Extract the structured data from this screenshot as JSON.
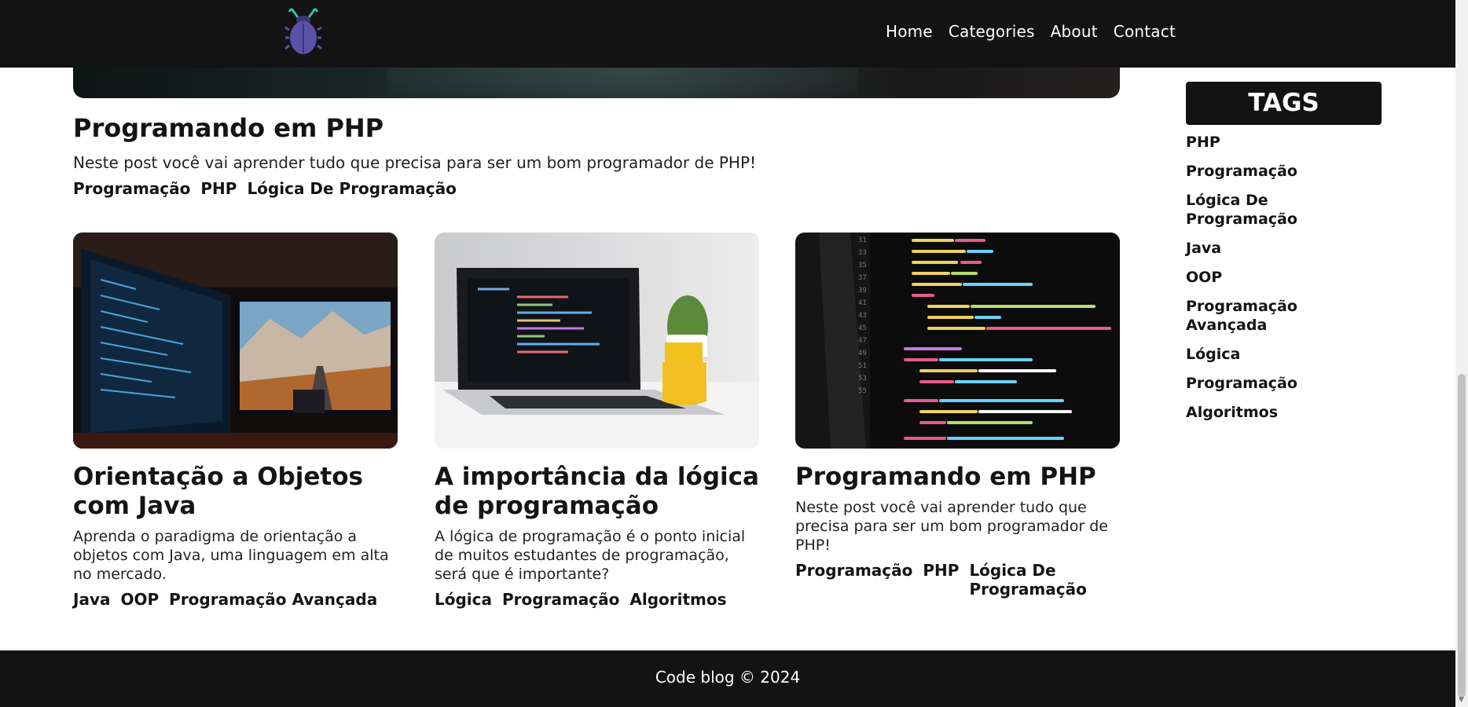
{
  "nav": {
    "logo_icon": "bug-icon",
    "links": [
      "Home",
      "Categories",
      "About",
      "Contact"
    ]
  },
  "featured": {
    "title": "Programando em PHP",
    "description": "Neste post você vai aprender tudo que precisa para ser um bom programador de PHP!",
    "tags": [
      "Programação",
      "PHP",
      "Lógica De Programação"
    ]
  },
  "posts": [
    {
      "title": "Orientação a Objetos com Java",
      "description": "Aprenda o paradigma de orientação a objetos com Java, uma linguagem em alta no mercado.",
      "tags": [
        "Java",
        "OOP",
        "Programação Avançada"
      ],
      "image": "dual-monitor-setup-image"
    },
    {
      "title": "A importância da lógica de programação",
      "description": "A lógica de programação é o ponto inicial de muitos estudantes de programação, será que é importante?",
      "tags": [
        "Lógica",
        "Programação",
        "Algoritmos"
      ],
      "image": "laptop-on-desk-image"
    },
    {
      "title": "Programando em PHP",
      "description": "Neste post você vai aprender tudo que precisa para ser um bom programador de PHP!",
      "tags": [
        "Programação",
        "PHP",
        "Lógica De Programação"
      ],
      "image": "code-screen-image"
    }
  ],
  "sidebar": {
    "header": "TAGS",
    "tags": [
      "PHP",
      "Programação",
      "Lógica De Programação",
      "Java",
      "OOP",
      "Programação Avançada",
      "Lógica",
      "Programação",
      "Algoritmos"
    ]
  },
  "footer": {
    "text": "Code blog © 2024"
  },
  "colors": {
    "navbar_bg": "#131313",
    "footer_bg": "#131313",
    "logo_body": "#5b52a8",
    "logo_accent": "#3fb9a8"
  }
}
